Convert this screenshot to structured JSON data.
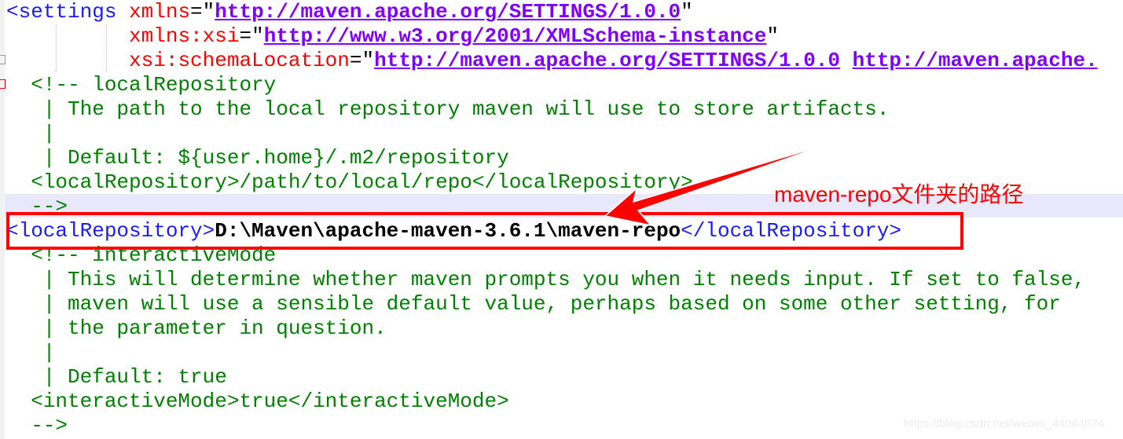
{
  "editor": {
    "lines": [
      [
        [
          "tag",
          "<settings "
        ],
        [
          "attr",
          "xmlns"
        ],
        [
          "eq",
          "=\""
        ],
        [
          "url",
          "http://maven.apache.org/SETTINGS/1.0.0"
        ],
        [
          "eq",
          "\""
        ]
      ],
      [
        [
          "eq",
          "          "
        ],
        [
          "attr",
          "xmlns:xsi"
        ],
        [
          "eq",
          "=\""
        ],
        [
          "url",
          "http://www.w3.org/2001/XMLSchema-instance"
        ],
        [
          "eq",
          "\""
        ]
      ],
      [
        [
          "eq",
          "          "
        ],
        [
          "attr",
          "xsi:schemaLocation"
        ],
        [
          "eq",
          "=\""
        ],
        [
          "url",
          "http://maven.apache.org/SETTINGS/1.0.0"
        ],
        [
          "eq",
          " "
        ],
        [
          "url",
          "http://maven.apache."
        ]
      ],
      [
        [
          "cm",
          "  <!-- localRepository"
        ]
      ],
      [
        [
          "cm",
          "   | The path to the local repository maven will use to store artifacts."
        ]
      ],
      [
        [
          "cm",
          "   |"
        ]
      ],
      [
        [
          "cm",
          "   | Default: ${user.home}/.m2/repository"
        ]
      ],
      [
        [
          "cm",
          "  <localRepository>/path/to/local/repo</localRepository>"
        ]
      ],
      [
        [
          "cm",
          "  -->"
        ]
      ],
      [
        [
          "tag",
          "<localRepository>"
        ],
        [
          "val",
          "D:\\Maven\\apache-maven-3.6.1\\maven-repo"
        ],
        [
          "tag",
          "</localRepository>"
        ]
      ],
      [
        [
          "cm",
          "  <!-- interactiveMode"
        ]
      ],
      [
        [
          "cm",
          "   | This will determine whether maven prompts you when it needs input. If set to false,"
        ]
      ],
      [
        [
          "cm",
          "   | maven will use a sensible default value, perhaps based on some other setting, for"
        ]
      ],
      [
        [
          "cm",
          "   | the parameter in question."
        ]
      ],
      [
        [
          "cm",
          "   |"
        ]
      ],
      [
        [
          "cm",
          "   | Default: true"
        ]
      ],
      [
        [
          "cm",
          "  <interactiveMode>true</interactiveMode>"
        ]
      ],
      [
        [
          "cm",
          "  -->"
        ]
      ]
    ]
  },
  "annotation": {
    "text": "maven-repo文件夹的路径",
    "color": "#ff0000"
  },
  "watermark": "https://blog.csdn.net/weixin_44064074"
}
